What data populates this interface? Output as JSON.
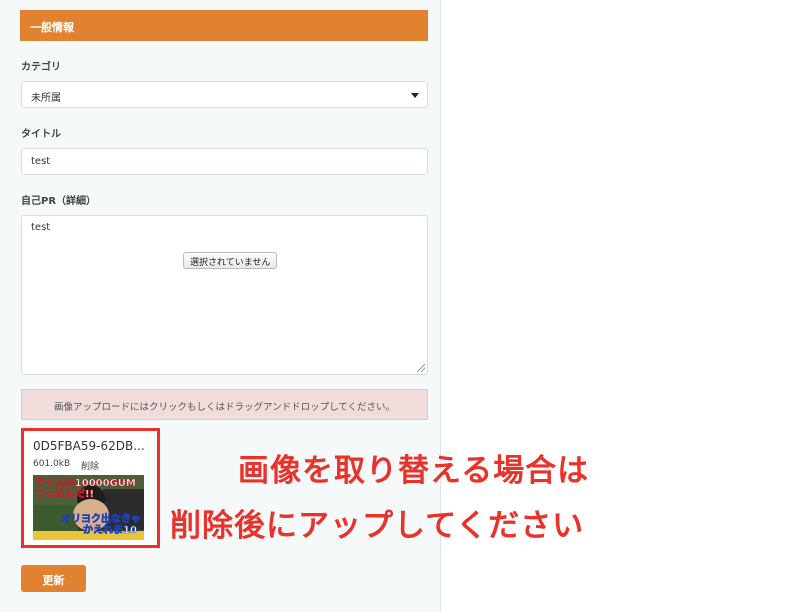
{
  "section": {
    "title": "一般情報"
  },
  "category": {
    "label": "カテゴリ",
    "value": "未所属"
  },
  "title_field": {
    "label": "タイトル",
    "value": "test"
  },
  "pr_field": {
    "label": "自己PR（詳細）",
    "value": "test"
  },
  "file_input": {
    "label": "選択されていません"
  },
  "dropzone": {
    "text": "画像アップロードにはクリックもしくはドラッグアンドドロップしてください。"
  },
  "uploaded_file": {
    "name": "0D5FBA59-62DB...",
    "size": "601.0kB",
    "delete_label": "削除",
    "thumb_line1": "ライムは10000GUM",
    "thumb_line2": "つっ込んだ!!",
    "thumb_line3": "オリヨク出なきゃ",
    "thumb_line4": "かえれま10"
  },
  "annotation": {
    "line1": "画像を取り替える場合は",
    "line2": "削除後にアップしてください",
    "color": "#e8322a"
  },
  "buttons": {
    "update": "更新"
  },
  "colors": {
    "accent": "#e0822f",
    "panel_bg": "#f5f9fa"
  }
}
